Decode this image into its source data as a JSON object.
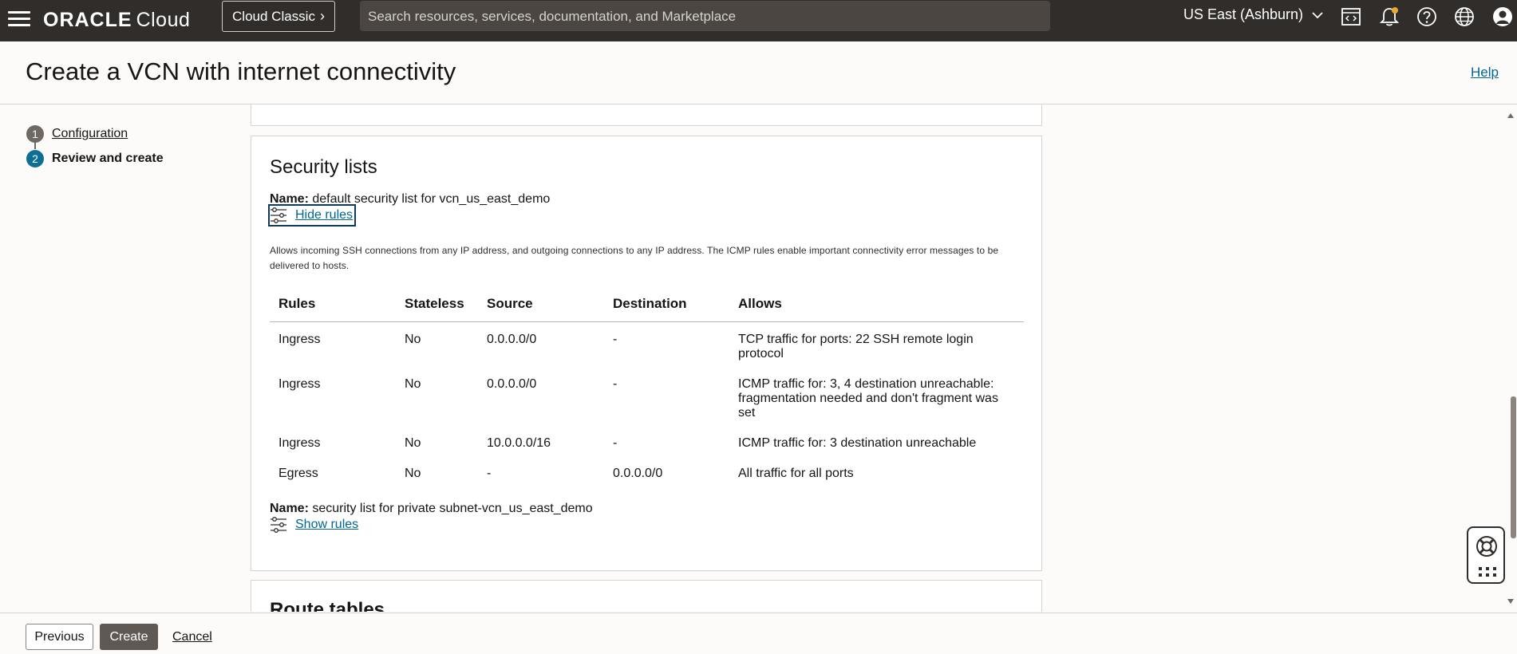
{
  "topbar": {
    "logo_brand": "ORACLE",
    "logo_product": "Cloud",
    "classic_label": "Cloud Classic",
    "classic_chevron": "›",
    "search_placeholder": "Search resources, services, documentation, and Marketplace",
    "region": "US East (Ashburn)",
    "icons": [
      "menu-icon",
      "code-editor-icon",
      "bell-icon",
      "help-icon",
      "globe-icon",
      "profile-icon"
    ]
  },
  "header": {
    "title": "Create a VCN with internet connectivity",
    "help": "Help"
  },
  "steps": [
    {
      "number": "1",
      "label": "Configuration"
    },
    {
      "number": "2",
      "label": "Review and create"
    }
  ],
  "security_lists": {
    "title": "Security lists",
    "name_label": "Name:",
    "list1": {
      "name": "default security list for vcn_us_east_demo",
      "toggle": "Hide rules",
      "description": "Allows incoming SSH connections from any IP address, and outgoing connections to any IP address. The ICMP rules enable important connectivity error messages to be delivered to hosts.",
      "columns": [
        "Rules",
        "Stateless",
        "Source",
        "Destination",
        "Allows"
      ],
      "rows": [
        [
          "Ingress",
          "No",
          "0.0.0.0/0",
          "-",
          "TCP traffic for ports: 22 SSH remote login protocol"
        ],
        [
          "Ingress",
          "No",
          "0.0.0.0/0",
          "-",
          "ICMP traffic for: 3, 4 destination unreachable: fragmentation needed and don't fragment was set"
        ],
        [
          "Ingress",
          "No",
          "10.0.0.0/16",
          "-",
          "ICMP traffic for: 3 destination unreachable"
        ],
        [
          "Egress",
          "No",
          "-",
          "0.0.0.0/0",
          "All traffic for all ports"
        ]
      ]
    },
    "list2": {
      "name": "security list for private subnet-vcn_us_east_demo",
      "toggle": "Show rules"
    }
  },
  "route_tables": {
    "title": "Route tables"
  },
  "footer": {
    "previous": "Previous",
    "create": "Create",
    "cancel": "Cancel"
  },
  "colors": {
    "topbar": "#312d2a",
    "link": "#00688c",
    "active_step": "#0e6f94",
    "primary_button": "#5f5853"
  }
}
